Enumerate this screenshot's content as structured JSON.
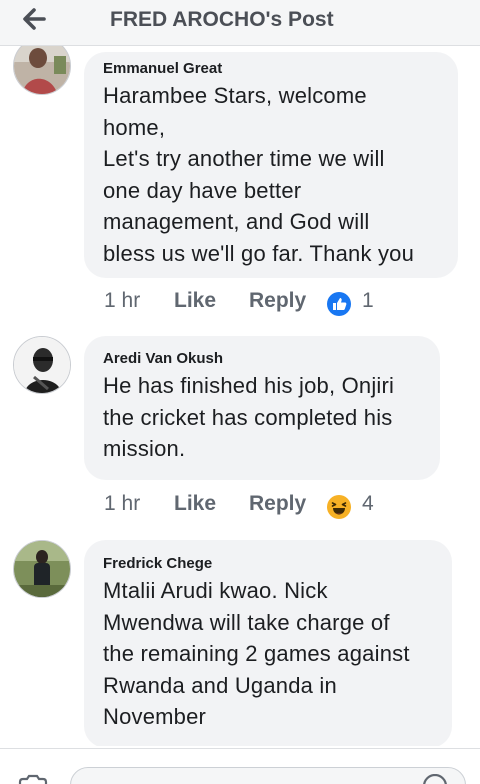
{
  "header": {
    "title": "FRED AROCHO's Post",
    "back_icon": "back-arrow-icon"
  },
  "comments": [
    {
      "author": "Emmanuel Great",
      "lines": [
        "Harambee Stars, welcome",
        "home,",
        "Let's try another time we will",
        "one day have better",
        "management, and God will",
        "bless us we'll go far. Thank you"
      ],
      "time": "1 hr",
      "like_label": "Like",
      "reply_label": "Reply",
      "reaction_icon": "like-reaction-icon",
      "reaction_count": "1"
    },
    {
      "author": "Aredi Van Okush",
      "lines": [
        "He has finished his job, Onjiri",
        "the cricket has completed his",
        "mission."
      ],
      "time": "1 hr",
      "like_label": "Like",
      "reply_label": "Reply",
      "reaction_icon": "haha-reaction-icon",
      "reaction_count": "4"
    },
    {
      "author": "Fredrick Chege",
      "lines": [
        "Mtalii Arudi kwao. Nick",
        "Mwendwa will take charge of",
        "the remaining 2 games against",
        "Rwanda and Uganda in",
        "November"
      ]
    }
  ],
  "colors": {
    "header_bg": "#f5f6f7",
    "bubble_bg": "#f2f3f5",
    "like_blue": "#1877f2",
    "haha_yellow": "#f7b125",
    "meta_gray": "#606770"
  }
}
